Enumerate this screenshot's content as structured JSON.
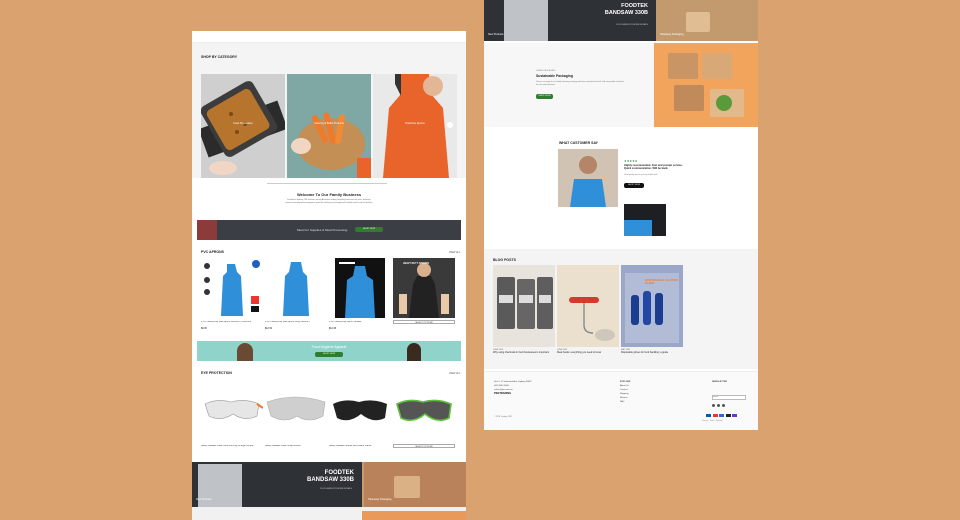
{
  "colors": {
    "background": "#d9a26f",
    "brand_green": "#2e7d32",
    "teal_banner": "#8fd3cb",
    "apron_blue": "#2f8fd8",
    "apron_orange": "#e8642a"
  },
  "left": {
    "shop_by_category": {
      "title": "SHOP BY CATEGORY",
      "items": [
        "Food Preparation",
        "Catering & Buffet Products",
        "Protective Aprons"
      ]
    },
    "welcome": {
      "title": "Welcome To Our Family Business",
      "body": "Founded in Sydney, PKE has been serving Australia's leading hospitality businesses for years, delivering premium food preparation equipment, protective clothing and packaging with friendly service and fast delivery."
    },
    "banner1": {
      "text": "Meat For Supplies & Meat Processing",
      "button": "SHOP NOW"
    },
    "pvc_aprons": {
      "title": "PVC APRONS",
      "view_all": "VIEW ALL",
      "products": [
        {
          "name": "PVC Heavy Duty Blue Apron 1000mm x 1200mm",
          "price": "$9.95"
        },
        {
          "name": "PVC Heavy Duty Blue Apron Long 1200mm",
          "price": "$12.50"
        },
        {
          "name": "PVC Heavy Duty Apron Flexible",
          "price": "$14.95"
        },
        {
          "name": "Heavy Duty Apron Black",
          "price": ""
        }
      ],
      "badge": "HEAVY DUTY APRONS",
      "select_btn": "SELECT OPTIONS"
    },
    "banner2": {
      "text": "Food Hygiene Apparel",
      "button": "SHOP NOW"
    },
    "eye_protection": {
      "title": "EYE PROTECTION",
      "view_all": "VIEW ALL",
      "products": [
        {
          "name": "Safety Glasses Clear Lens Anti Fog Orange Temple"
        },
        {
          "name": "Safety Glasses Clear Wrap Around"
        },
        {
          "name": "Safety Glasses Smoke Lens Black Frame"
        },
        {
          "name": "Safety Glasses Grey Lens Green Temple"
        }
      ],
      "select_btn": "SELECT OPTIONS"
    },
    "promo": {
      "brand": "FOODTEK",
      "model": "BANDSAW 330B",
      "sub": "CLICK HERE FOR MORE DETAILS",
      "label1": "New Products",
      "label2": "Takeaway Packaging"
    }
  },
  "right": {
    "promo": {
      "brand": "FOODTEK",
      "model": "BANDSAW 330B",
      "sub": "CLICK HERE FOR MORE DETAILS",
      "label1": "New Products",
      "label2": "Takeaway Packaging"
    },
    "sustainable": {
      "eyebrow": "GREEN PACKAGING",
      "title": "Sustainable Packaging",
      "body": "Discover our range of eco friendly takeaway packaging made from renewable materials, fully compostable and perfect for cafes and restaurants.",
      "button": "SHOP NOW"
    },
    "testimonials": {
      "title": "WHAT CUSTOMER SAY",
      "stars": "★★★★★",
      "quote": "Highly recommended. Fast and prompt service. Quick communication. Will be back.",
      "sub": "Great quality aprons and very helpful staff.",
      "button": "SHOP NOW"
    },
    "blog": {
      "title": "BLOG POSTS",
      "posts": [
        {
          "date": "JUNE 2023",
          "title": "Why using chemicals in food businesses is important"
        },
        {
          "date": "JUNE 2023",
          "title": "Meat hooks: everything you need to know"
        },
        {
          "date": "MAY 2023",
          "title": "Disposable gloves for food handling: a guide"
        }
      ],
      "tile_text": "DISPOSABLE GLOVES GUIDE"
    },
    "footer": {
      "address": [
        "Unit 5, 12 Industrial Ave, Sydney NSW",
        "(02) 9000 0000",
        "sales@pke.com.au"
      ],
      "logo": "PKETRADING",
      "col2_title": "EXPLORE",
      "col2": [
        "About Us",
        "Contact",
        "Shipping",
        "Returns",
        "FAQ"
      ],
      "col3_title": "NEWSLETTER",
      "email_placeholder": "Email",
      "copyright": "© PKE Trading 2023",
      "links": "Privacy · Terms · Refunds"
    }
  }
}
